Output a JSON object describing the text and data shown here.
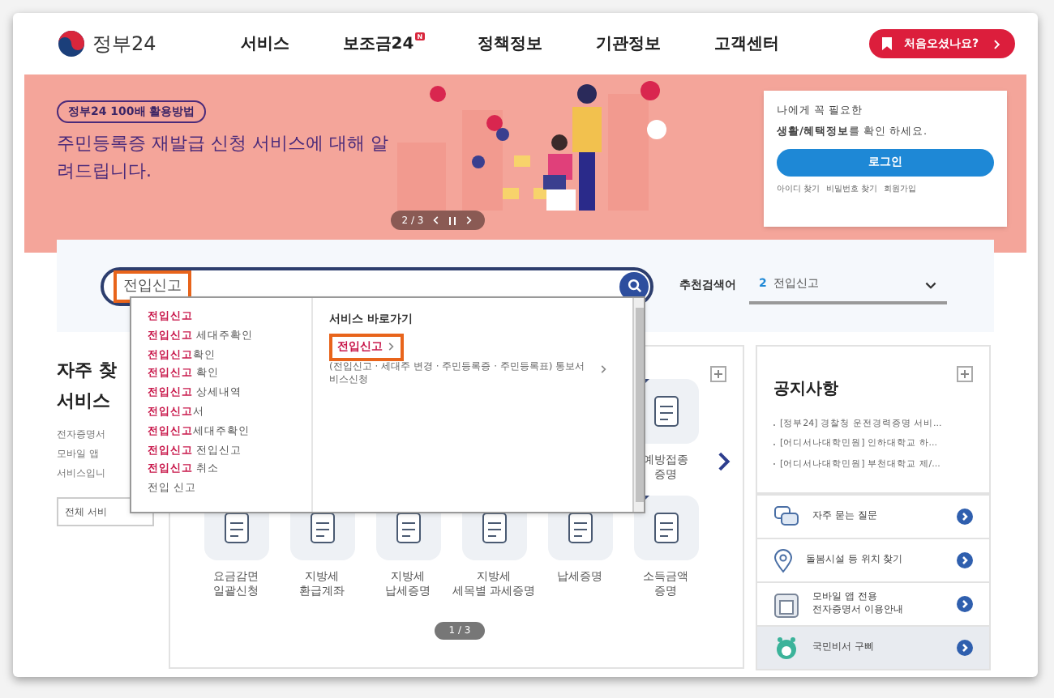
{
  "header": {
    "logo": "정부24",
    "nav": [
      {
        "label": "서비스"
      },
      {
        "label": "보조금24",
        "badge": "N"
      },
      {
        "label": "정책정보"
      },
      {
        "label": "기관정보"
      },
      {
        "label": "고객센터"
      }
    ],
    "first_visit_button": "처음오셨나요?"
  },
  "banner": {
    "tag": "정부24 100배 활용방법",
    "headline": "주민등록증 재발급 신청 서비스에 대해 알려드립니다.",
    "pager": "2 / 3"
  },
  "login_card": {
    "line1": "나에게 꼭 필요한",
    "line2": "**생활/혜택정보**를 확인 하세요.",
    "login_button": "로그인",
    "links": [
      "아이디 찾기",
      "비밀번호 찾기",
      "회원가입"
    ]
  },
  "search": {
    "value": "전입신고",
    "recommend_label": "추천검색어",
    "recommend_rank": "2",
    "recommend_term": "전입신고"
  },
  "autocomplete": {
    "suggestions": [
      {
        "match": "전입신고"
      },
      {
        "match": "전입신고",
        "rest": " 세대주확인"
      },
      {
        "match": "전입신고",
        "rest": "확인"
      },
      {
        "match": "전입신고",
        "rest": " 확인"
      },
      {
        "match": "전입신고",
        "rest": " 상세내역"
      },
      {
        "match": "전입신고",
        "rest": "서"
      },
      {
        "match": "전입신고",
        "rest": "세대주확인"
      },
      {
        "match": "전입신고",
        "rest": " 전입신고"
      },
      {
        "match": "전입신고",
        "rest": " 취소"
      },
      {
        "rest": "전입 신고"
      }
    ],
    "shortcut_heading": "서비스 바로가기",
    "shortcut": "전입신고",
    "shortcut_desc": "(전입신고 · 세대주 변경 · 주민등록증 · 주민등록표) 통보서비스신청"
  },
  "frequent": {
    "title_1": "자주 찾",
    "title_2": "서비스",
    "desc": [
      "전자증명서",
      "모바일 앱",
      "서비스입니"
    ],
    "all_button": "전체 서비"
  },
  "services": {
    "top": [
      {
        "label": "예방접종 증명"
      }
    ],
    "bottom": [
      {
        "label": "요금감면 일괄신청"
      },
      {
        "label": "지방세 환급계좌"
      },
      {
        "label": "지방세 납세증명"
      },
      {
        "label": "지방세 세목별 과세증명"
      },
      {
        "label": "납세증명"
      },
      {
        "label": "소득금액 증명"
      }
    ],
    "pager": "1 / 3"
  },
  "notices": {
    "title": "공지사항",
    "items": [
      "[정부24] 경찰청 운전경력증명 서비...",
      "[어디서나대학민원] 인하대학교 하...",
      "[어디서나대학민원] 부천대학교 제/..."
    ]
  },
  "quick_links": [
    {
      "kind": "faq",
      "label": "자주 묻는 질문",
      "selected": false
    },
    {
      "kind": "location",
      "label": "돌봄시설 등 위치 찾기",
      "selected": false
    },
    {
      "kind": "mobile",
      "label": "모바일 앱 전용\n전자증명서 이용안내",
      "selected": false
    },
    {
      "kind": "assistant",
      "label": "국민비서 구삐",
      "selected": true
    }
  ]
}
